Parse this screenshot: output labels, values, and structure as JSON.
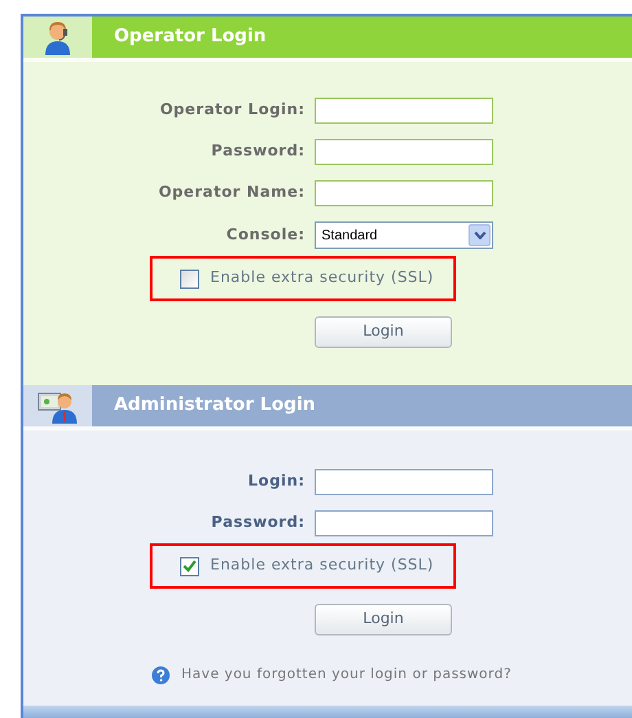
{
  "panels": [
    {
      "kind": "operator",
      "title": "Operator Login",
      "fields": [
        {
          "kind": "text",
          "label": "Operator Login:"
        },
        {
          "kind": "password",
          "label": "Password:"
        },
        {
          "kind": "text",
          "label": "Operator Name:"
        },
        {
          "kind": "select",
          "label": "Console:",
          "value": "Standard"
        }
      ],
      "ssl": {
        "label": "Enable extra security (SSL)",
        "checked": false
      },
      "button": "Login"
    },
    {
      "kind": "administrator",
      "title": "Administrator Login",
      "fields": [
        {
          "kind": "text",
          "label": "Login:"
        },
        {
          "kind": "password",
          "label": "Password:"
        }
      ],
      "ssl": {
        "label": "Enable extra security (SSL)",
        "checked": true
      },
      "button": "Login",
      "help": "Have you forgotten your login or password?"
    }
  ]
}
